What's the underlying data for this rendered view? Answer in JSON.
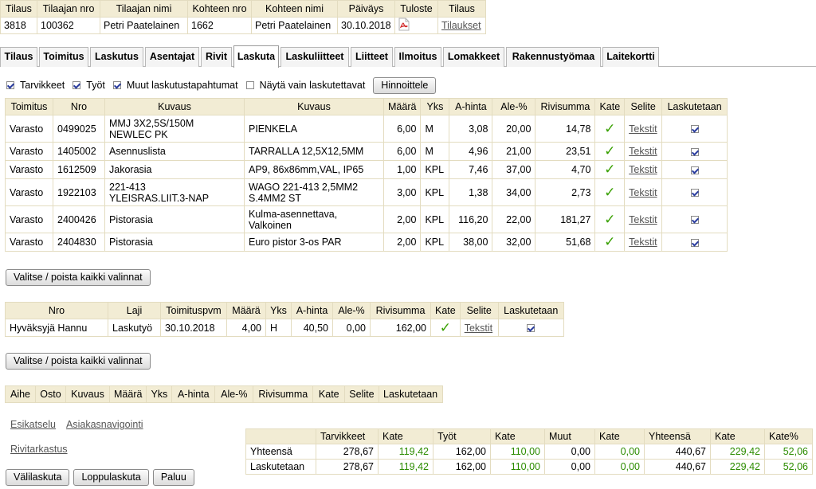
{
  "order_header": {
    "columns": [
      "Tilaus",
      "Tilaajan nro",
      "Tilaajan nimi",
      "Kohteen nro",
      "Kohteen nimi",
      "Päiväys",
      "Tuloste",
      "Tilaus"
    ],
    "tilaus": "3818",
    "tilaajan_nro": "100362",
    "tilaajan_nimi": "Petri Paatelainen",
    "kohteen_nro": "1662",
    "kohteen_nimi": "Petri Paatelainen",
    "paivays": "30.10.2018",
    "tuloste_icon": "pdf-icon",
    "tilaukset_link": "Tilaukset"
  },
  "tabs": [
    "Tilaus",
    "Toimitus",
    "Laskutus",
    "Asentajat",
    "Rivit",
    "Laskuta",
    "Laskuliitteet",
    "Liitteet",
    "Ilmoitus",
    "Lomakkeet",
    "Rakennustyömaa",
    "Laitekortti"
  ],
  "active_tab": "Laskuta",
  "filters": {
    "tarvikkeet": "Tarvikkeet",
    "tyot": "Työt",
    "muut": "Muut laskutustapahtumat",
    "nayta": "Näytä vain laskutettavat",
    "hinnoittele": "Hinnoittele"
  },
  "materials": {
    "headers": [
      "Toimitus",
      "Nro",
      "Kuvaus",
      "Kuvaus",
      "Määrä",
      "Yks",
      "A-hinta",
      "Ale-%",
      "Rivisumma",
      "Kate",
      "Selite",
      "Laskutetaan"
    ],
    "rows": [
      {
        "toimitus": "Varasto",
        "nro": "0499025",
        "kuvaus1a": "MMJ 3X2,5S/150M",
        "kuvaus1b": "NEWLEC PK",
        "kuvaus2a": "PIENKELA",
        "kuvaus2b": "",
        "maara": "6,00",
        "yks": "M",
        "ahinta": "3,08",
        "ale": "20,00",
        "rivisumma": "14,78",
        "selite": "Tekstit"
      },
      {
        "toimitus": "Varasto",
        "nro": "1405002",
        "kuvaus1a": "Asennuslista",
        "kuvaus1b": "",
        "kuvaus2a": "TARRALLA 12,5X12,5MM",
        "kuvaus2b": "",
        "maara": "6,00",
        "yks": "M",
        "ahinta": "4,96",
        "ale": "21,00",
        "rivisumma": "23,51",
        "selite": "Tekstit"
      },
      {
        "toimitus": "Varasto",
        "nro": "1612509",
        "kuvaus1a": "Jakorasia",
        "kuvaus1b": "",
        "kuvaus2a": "AP9, 86x86mm,VAL, IP65",
        "kuvaus2b": "",
        "maara": "1,00",
        "yks": "KPL",
        "ahinta": "7,46",
        "ale": "37,00",
        "rivisumma": "4,70",
        "selite": "Tekstit"
      },
      {
        "toimitus": "Varasto",
        "nro": "1922103",
        "kuvaus1a": "221-413",
        "kuvaus1b": "YLEISRAS.LIIT.3-NAP",
        "kuvaus2a": "WAGO 221-413 2,5MM2",
        "kuvaus2b": "S.4MM2 ST",
        "maara": "3,00",
        "yks": "KPL",
        "ahinta": "1,38",
        "ale": "34,00",
        "rivisumma": "2,73",
        "selite": "Tekstit"
      },
      {
        "toimitus": "Varasto",
        "nro": "2400426",
        "kuvaus1a": "Pistorasia",
        "kuvaus1b": "",
        "kuvaus2a": "Kulma-asennettava,",
        "kuvaus2b": "Valkoinen",
        "maara": "2,00",
        "yks": "KPL",
        "ahinta": "116,20",
        "ale": "22,00",
        "rivisumma": "181,27",
        "selite": "Tekstit"
      },
      {
        "toimitus": "Varasto",
        "nro": "2404830",
        "kuvaus1a": "Pistorasia",
        "kuvaus1b": "",
        "kuvaus2a": "Euro pistor 3-os PAR",
        "kuvaus2b": "",
        "maara": "2,00",
        "yks": "KPL",
        "ahinta": "38,00",
        "ale": "32,00",
        "rivisumma": "51,68",
        "selite": "Tekstit"
      }
    ]
  },
  "select_all_label": "Valitse / poista kaikki valinnat",
  "labor": {
    "headers": [
      "Nro",
      "Laji",
      "Toimituspvm",
      "Määrä",
      "Yks",
      "A-hinta",
      "Ale-%",
      "Rivisumma",
      "Kate",
      "Selite",
      "Laskutetaan"
    ],
    "rows": [
      {
        "nro": "Hyväksyjä Hannu",
        "laji": "Laskutyö",
        "pvm": "30.10.2018",
        "maara": "4,00",
        "yks": "H",
        "ahinta": "40,50",
        "ale": "0,00",
        "rivisumma": "162,00",
        "selite": "Tekstit"
      }
    ]
  },
  "other": {
    "headers": [
      "Aihe",
      "Osto",
      "Kuvaus",
      "Määrä",
      "Yks",
      "A-hinta",
      "Ale-%",
      "Rivisumma",
      "Kate",
      "Selite",
      "Laskutetaan"
    ]
  },
  "links": {
    "esikatselu": "Esikatselu",
    "asiakasnavigointi": "Asiakasnavigointi",
    "rivitarkastus": "Rivitarkastus"
  },
  "summary": {
    "headers": [
      "",
      "Tarvikkeet",
      "Kate",
      "Työt",
      "Kate",
      "Muut",
      "Kate",
      "Yhteensä",
      "Kate",
      "Kate%"
    ],
    "rows": [
      {
        "label": "Yhteensä",
        "tarvikkeet": "278,67",
        "kate1": "119,42",
        "tyot": "162,00",
        "kate2": "110,00",
        "muut": "0,00",
        "kate3": "0,00",
        "yhteensa": "440,67",
        "kate4": "229,42",
        "katepct": "52,06"
      },
      {
        "label": "Laskutetaan",
        "tarvikkeet": "278,67",
        "kate1": "119,42",
        "tyot": "162,00",
        "kate2": "110,00",
        "muut": "0,00",
        "kate3": "0,00",
        "yhteensa": "440,67",
        "kate4": "229,42",
        "katepct": "52,06"
      }
    ]
  },
  "actions": {
    "valilasku": "Välilaskuta",
    "loppulasku": "Loppulaskuta",
    "paluu": "Paluu"
  },
  "colors": {
    "header_bg": "#f2ecd4",
    "check_green": "#38a000",
    "kate_green": "#2c8c00"
  }
}
